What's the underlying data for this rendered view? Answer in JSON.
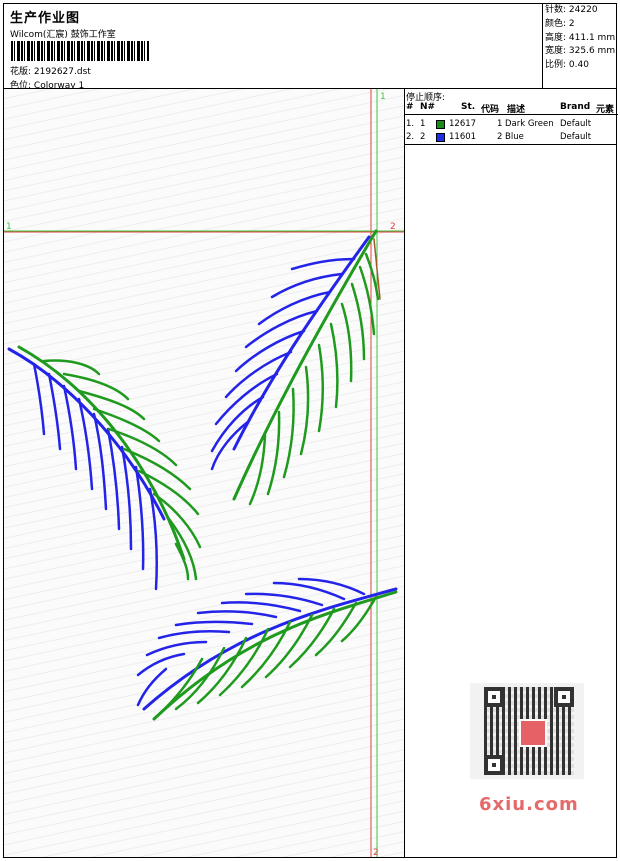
{
  "header": {
    "title": "生产作业图",
    "company": "Wilcom(汇宸) 鼓饰工作室",
    "pattern_label": "花版:",
    "pattern_value": "2192627.dst",
    "colorway_label": "色位:",
    "colorway_value": "Colorway 1"
  },
  "meta": [
    {
      "label": "针数:",
      "value": "24220"
    },
    {
      "label": "颜色:",
      "value": "2"
    },
    {
      "label": "高度:",
      "value": "411.1 mm"
    },
    {
      "label": "宽度:",
      "value": "325.6 mm"
    },
    {
      "label": "比例:",
      "value": "0.40"
    }
  ],
  "stops": {
    "title": "停止顺序:",
    "headers": [
      "#",
      "N#",
      "St.",
      "代码",
      "描述",
      "Brand",
      "元素"
    ],
    "rows": [
      {
        "idx": "1.",
        "n": "1",
        "st": "12617",
        "code": "1",
        "desc": "Dark Green",
        "brand": "Default",
        "color": "#1a8a1a"
      },
      {
        "idx": "2.",
        "n": "2",
        "st": "11601",
        "code": "2",
        "desc": "Blue",
        "brand": "Default",
        "color": "#1f2ee8"
      }
    ]
  },
  "markers": {
    "top_right_1": "1",
    "left_1": "1",
    "right_2": "2",
    "bottom_2": "2"
  },
  "colors": {
    "green": "#1f9a1f",
    "blue": "#2424e8",
    "red_guide": "#e04040",
    "green_guide": "#3cc43c"
  },
  "watermark": {
    "text": "6xiu.com"
  }
}
